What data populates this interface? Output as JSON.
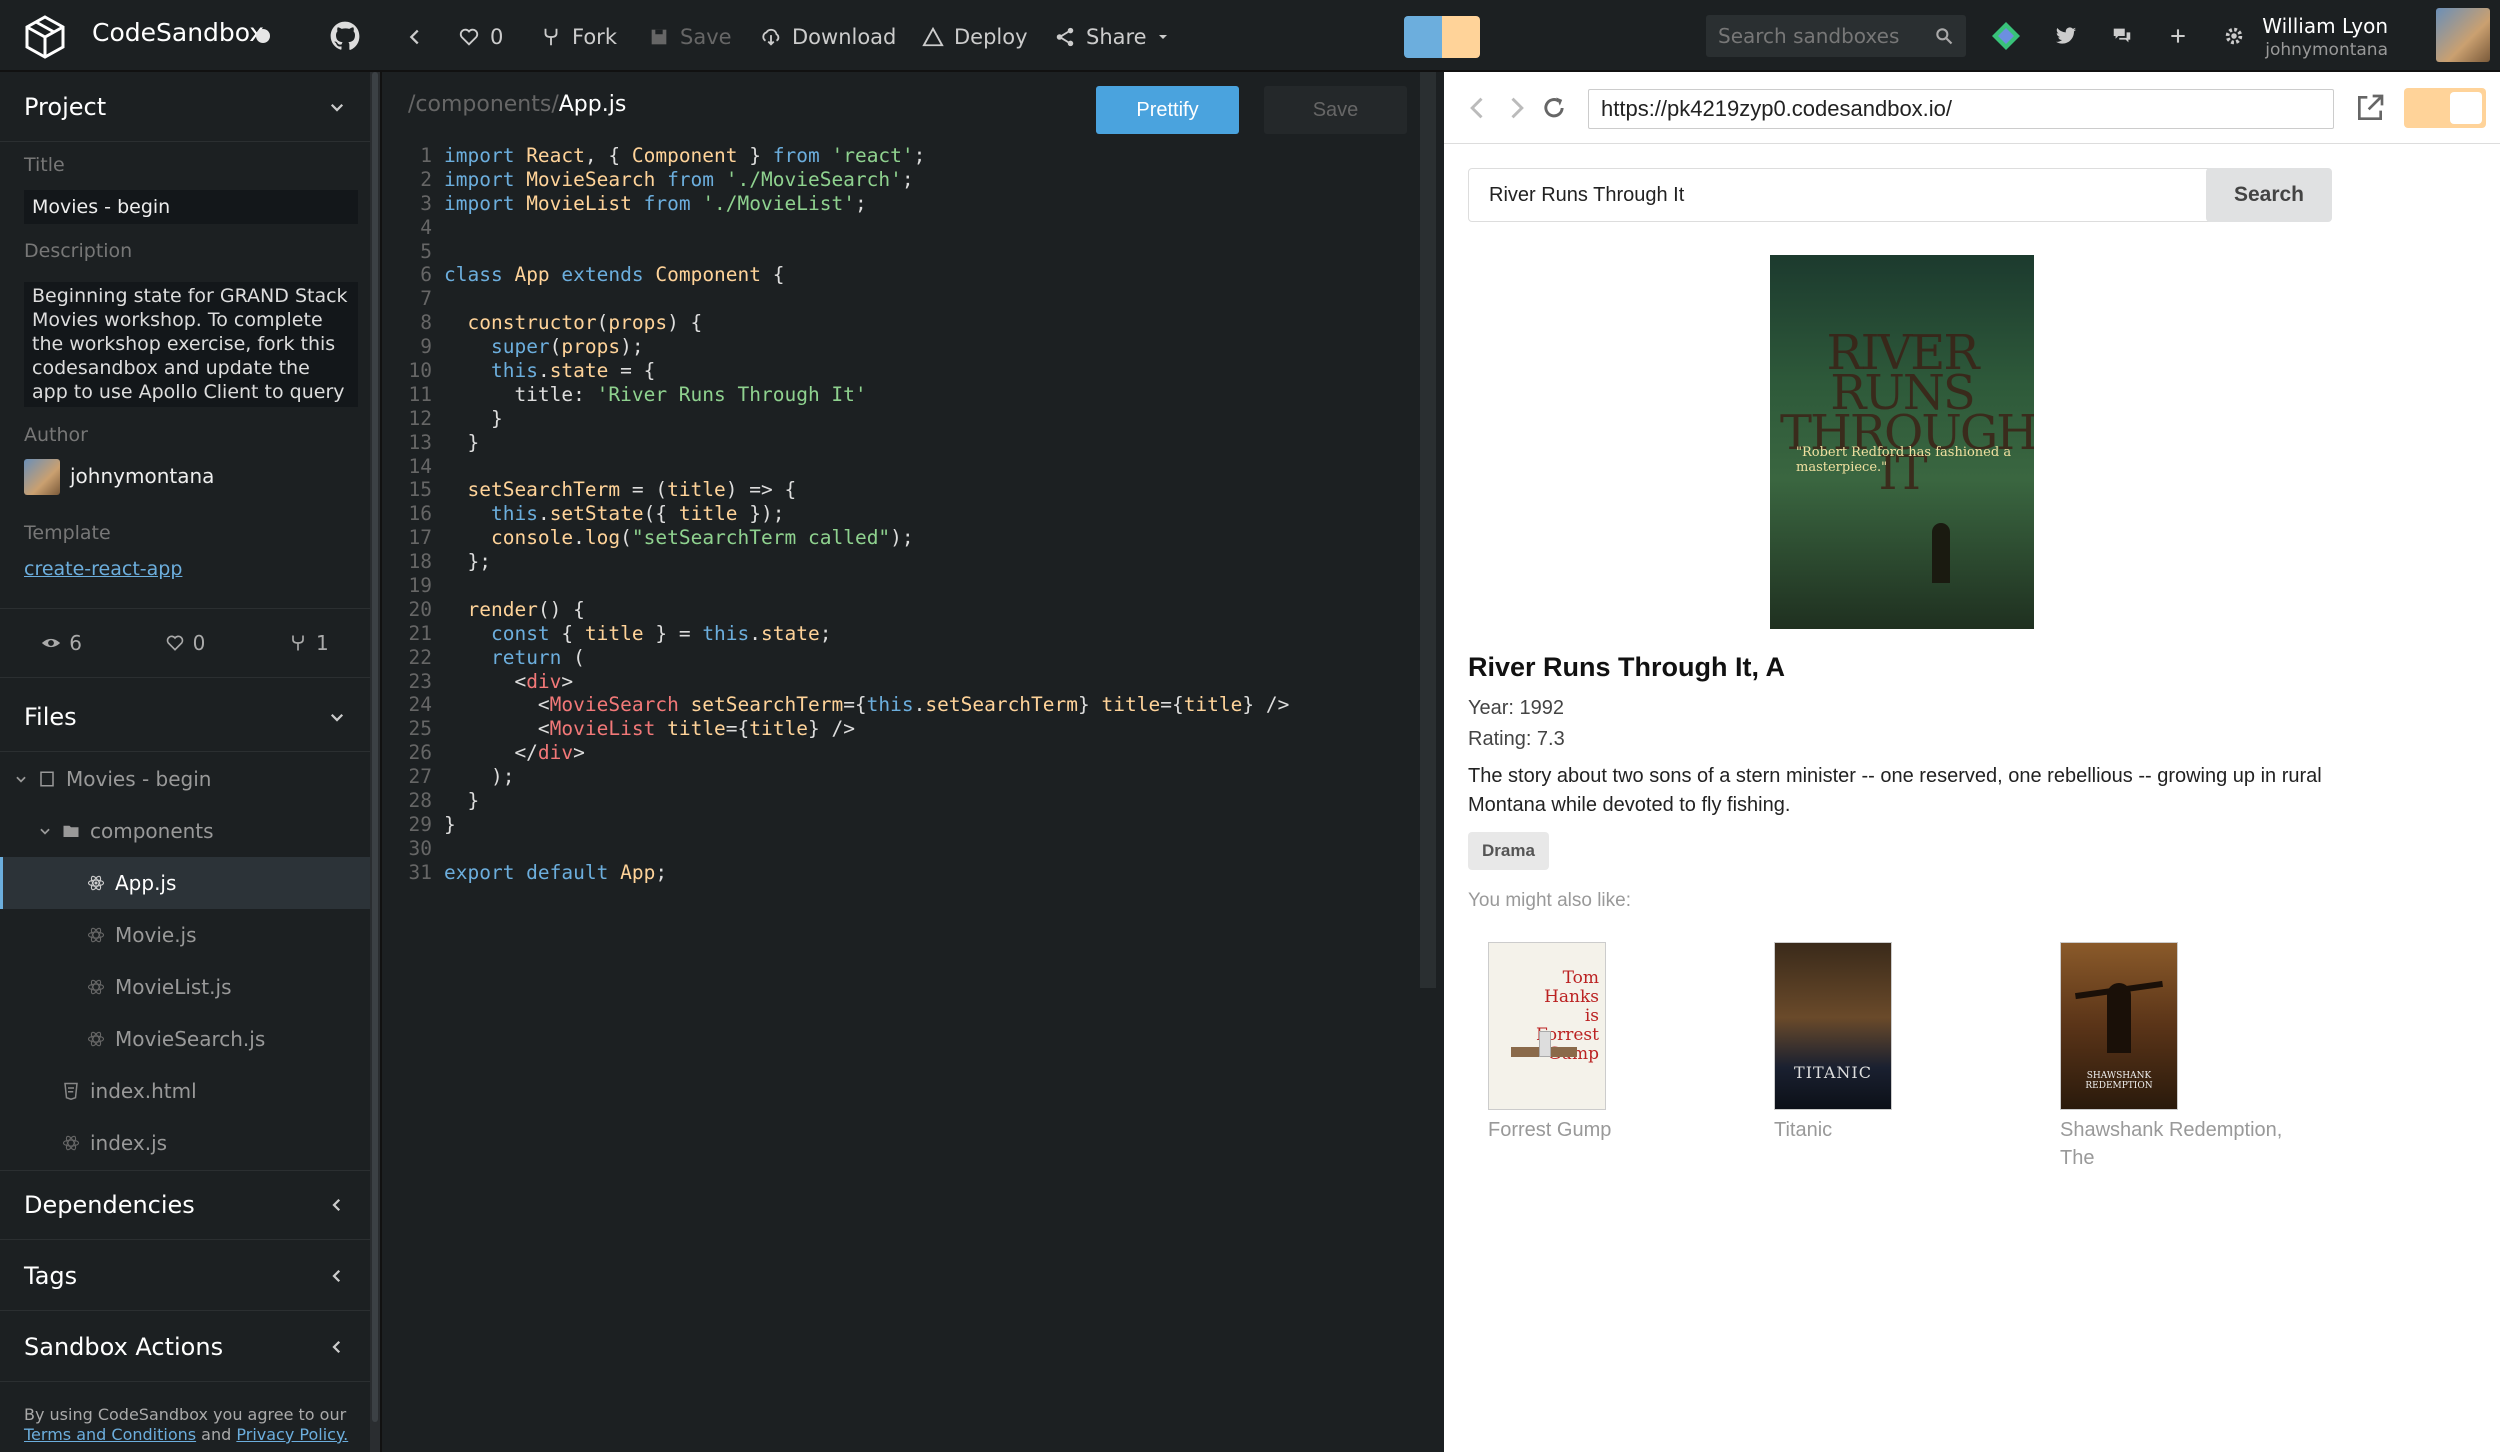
{
  "topbar": {
    "brand": "CodeSandbox",
    "likes": "0",
    "fork_label": "Fork",
    "save_label": "Save",
    "download_label": "Download",
    "deploy_label": "Deploy",
    "share_label": "Share",
    "search_placeholder": "Search sandboxes",
    "user_name": "William Lyon",
    "user_handle": "johnymontana"
  },
  "sidebar": {
    "project_header": "Project",
    "title_label": "Title",
    "title_value": "Movies - begin",
    "description_label": "Description",
    "description_value": "Beginning state for GRAND Stack Movies workshop. To complete the workshop exercise, fork this codesandbox and update the app to use Apollo Client to query the GraphQL API...",
    "author_label": "Author",
    "author_name": "johnymontana",
    "template_label": "Template",
    "template_value": "create-react-app",
    "views": "6",
    "likes": "0",
    "forks": "1",
    "files_header": "Files",
    "files": [
      {
        "label": "Movies - begin"
      },
      {
        "label": "components"
      },
      {
        "label": "App.js"
      },
      {
        "label": "Movie.js"
      },
      {
        "label": "MovieList.js"
      },
      {
        "label": "MovieSearch.js"
      },
      {
        "label": "index.html"
      },
      {
        "label": "index.js"
      }
    ],
    "dependencies_header": "Dependencies",
    "tags_header": "Tags",
    "actions_header": "Sandbox Actions",
    "footer_prefix": "By using CodeSandbox you agree to our",
    "footer_terms": "Terms and Conditions",
    "footer_and": "and",
    "footer_privacy": "Privacy Policy."
  },
  "editor": {
    "path_dir": "/components/",
    "path_file": "App.js",
    "prettify_label": "Prettify",
    "save_label": "Save"
  },
  "preview": {
    "url": "https://pk4219zyp0.codesandbox.io/",
    "search_value": "River Runs Through It",
    "search_button": "Search",
    "poster_title": "RIVER RUNS THROUGH IT",
    "poster_quote": "\"Robert Redford has fashioned a masterpiece.\"",
    "movie_title": "River Runs Through It, A",
    "year": "Year: 1992",
    "rating": "Rating: 7.3",
    "plot": "The story about two sons of a stern minister -- one reserved, one rebellious -- growing up in rural Montana while devoted to fly fishing.",
    "genre": "Drama",
    "also_like": "You might also like:",
    "recommendations": [
      {
        "title": "Forrest Gump",
        "poster_text": "Tom Hanks is Forrest Gump"
      },
      {
        "title": "Titanic",
        "poster_text": "TITANIC"
      },
      {
        "title": "Shawshank Redemption, The",
        "poster_text": "SHAWSHANK REDEMPTION"
      }
    ]
  },
  "colors": {
    "accent": "#6caedd",
    "prettify": "#4aa3de",
    "toggle_left": "#6caedd",
    "toggle_right": "#ffd399"
  }
}
